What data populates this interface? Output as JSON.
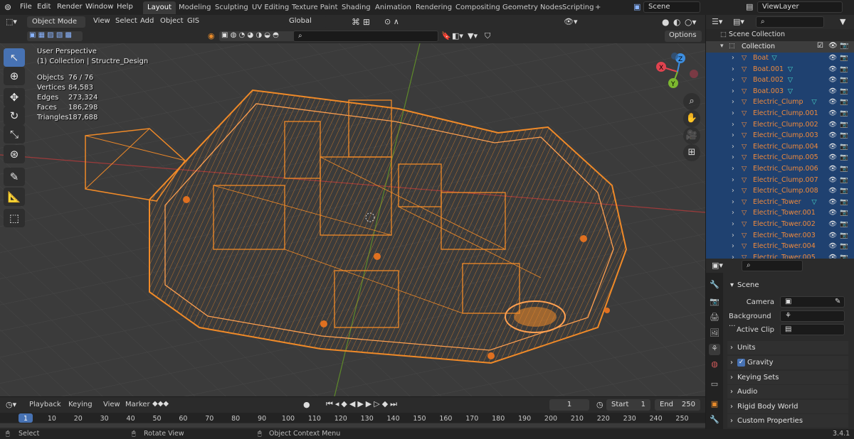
{
  "topbar": {
    "menus": [
      "File",
      "Edit",
      "Render",
      "Window",
      "Help"
    ],
    "workspaces": [
      "Layout",
      "Modeling",
      "Sculpting",
      "UV Editing",
      "Texture Paint",
      "Shading",
      "Animation",
      "Rendering",
      "Compositing",
      "Geometry Nodes",
      "Scripting"
    ],
    "active_workspace": "Layout",
    "add_tab": "+",
    "scene_field": "Scene",
    "viewlayer_field": "ViewLayer"
  },
  "viewport_header": {
    "mode": "Object Mode",
    "menus": [
      "View",
      "Select",
      "Add",
      "Object",
      "GIS"
    ],
    "orientation": "Global",
    "options_label": "Options"
  },
  "overlay_info": {
    "perspective": "User Perspective",
    "collection_line": "(1) Collection | Structre_Design",
    "stats": [
      {
        "label": "Objects",
        "value": "76 / 76"
      },
      {
        "label": "Vertices",
        "value": "84,583"
      },
      {
        "label": "Edges",
        "value": "273,324"
      },
      {
        "label": "Faces",
        "value": "186,298"
      },
      {
        "label": "Triangles",
        "value": "187,688"
      }
    ]
  },
  "gizmo": {
    "x": "X",
    "y": "Y",
    "z": "Z"
  },
  "outliner": {
    "root": "Scene Collection",
    "collection": "Collection",
    "items": [
      {
        "name": "Boat",
        "has_data": true
      },
      {
        "name": "Boat.001",
        "has_data": true
      },
      {
        "name": "Boat.002",
        "has_data": true
      },
      {
        "name": "Boat.003",
        "has_data": true
      },
      {
        "name": "Electric_Clump",
        "has_data": true
      },
      {
        "name": "Electric_Clump.001",
        "has_data": false
      },
      {
        "name": "Electric_Clump.002",
        "has_data": false
      },
      {
        "name": "Electric_Clump.003",
        "has_data": false
      },
      {
        "name": "Electric_Clump.004",
        "has_data": false
      },
      {
        "name": "Electric_Clump.005",
        "has_data": false
      },
      {
        "name": "Electric_Clump.006",
        "has_data": false
      },
      {
        "name": "Electric_Clump.007",
        "has_data": false
      },
      {
        "name": "Electric_Clump.008",
        "has_data": false
      },
      {
        "name": "Electric_Tower",
        "has_data": true
      },
      {
        "name": "Electric_Tower.001",
        "has_data": false
      },
      {
        "name": "Electric_Tower.002",
        "has_data": false
      },
      {
        "name": "Electric_Tower.003",
        "has_data": false
      },
      {
        "name": "Electric_Tower.004",
        "has_data": false
      },
      {
        "name": "Electric_Tower.005",
        "has_data": false
      }
    ]
  },
  "properties": {
    "panel_title": "Scene",
    "camera_label": "Camera",
    "background_label": "Background ...",
    "active_clip_label": "Active Clip",
    "sections": [
      "Units",
      "Gravity",
      "Keying Sets",
      "Audio",
      "Rigid Body World",
      "Custom Properties"
    ],
    "gravity_checked": true
  },
  "timeline": {
    "menus": [
      "Playback",
      "Keying",
      "View",
      "Marker"
    ],
    "current_frame": "1",
    "start_label": "Start",
    "start_value": "1",
    "end_label": "End",
    "end_value": "250",
    "ticks": [
      "1",
      "10",
      "20",
      "30",
      "40",
      "50",
      "60",
      "70",
      "80",
      "90",
      "100",
      "110",
      "120",
      "130",
      "140",
      "150",
      "160",
      "170",
      "180",
      "190",
      "200",
      "210",
      "220",
      "230",
      "240",
      "250"
    ]
  },
  "statusbar": {
    "select": "Select",
    "rotate": "Rotate View",
    "context": "Object Context Menu",
    "version": "3.4.1"
  },
  "colors": {
    "accent": "#4772b3",
    "wire": "#f08a28",
    "outliner_selected": "#1f4170",
    "x_axis": "#e0434f",
    "y_axis": "#7cb82f",
    "z_axis": "#3d8ee0"
  }
}
